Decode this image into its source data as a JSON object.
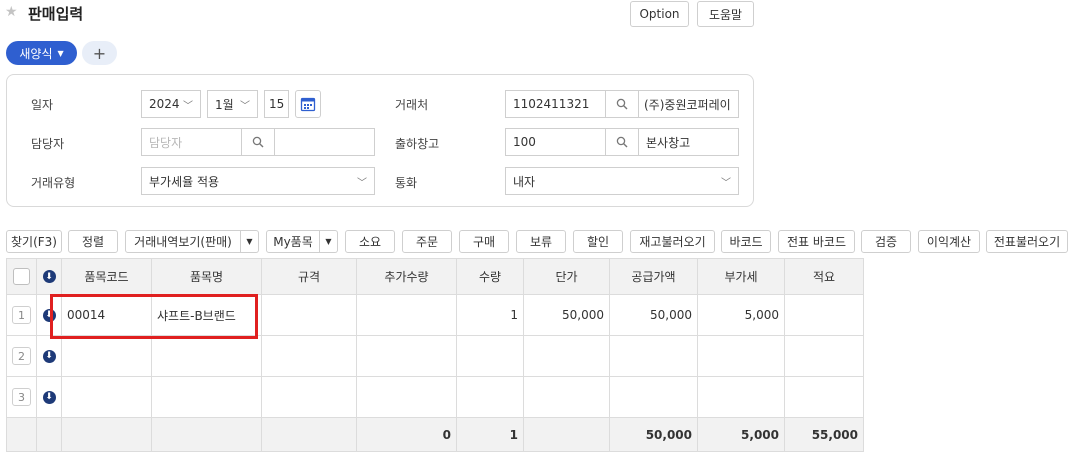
{
  "header": {
    "title": "판매입력",
    "option_label": "Option",
    "help_label": "도움말",
    "new_form_label": "새양식",
    "add_label": "+"
  },
  "form": {
    "date_label": "일자",
    "year": "2024",
    "month": "1월",
    "day": "15",
    "manager_label": "담당자",
    "manager_placeholder": "담당자",
    "trade_type_label": "거래유형",
    "trade_type_value": "부가세율 적용",
    "customer_label": "거래처",
    "customer_code": "1102411321",
    "customer_name": "(주)중원코퍼레이",
    "warehouse_label": "출하창고",
    "warehouse_code": "100",
    "warehouse_name": "본사창고",
    "currency_label": "통화",
    "currency_value": "내자"
  },
  "toolbar": {
    "find": "찾기(F3)",
    "sort": "정렬",
    "history": "거래내역보기(판매)",
    "my_items": "My품목",
    "consume": "소요",
    "order": "주문",
    "purchase": "구매",
    "hold": "보류",
    "discount": "할인",
    "stock_load": "재고불러오기",
    "barcode": "바코드",
    "slip_barcode": "전표 바코드",
    "verify": "검증",
    "profit": "이익계산",
    "slip_load": "전표불러오기"
  },
  "grid": {
    "headers": {
      "code": "품목코드",
      "name": "품목명",
      "spec": "규격",
      "extra_qty": "추가수량",
      "qty": "수량",
      "price": "단가",
      "supply": "공급가액",
      "vat": "부가세",
      "memo": "적요"
    },
    "rows": [
      {
        "num": "1",
        "code": "00014",
        "name": "샤프트-B브랜드",
        "spec": "",
        "extra_qty": "",
        "qty": "1",
        "price": "50,000",
        "supply": "50,000",
        "vat": "5,000",
        "memo": ""
      },
      {
        "num": "2",
        "code": "",
        "name": "",
        "spec": "",
        "extra_qty": "",
        "qty": "",
        "price": "",
        "supply": "",
        "vat": "",
        "memo": ""
      },
      {
        "num": "3",
        "code": "",
        "name": "",
        "spec": "",
        "extra_qty": "",
        "qty": "",
        "price": "",
        "supply": "",
        "vat": "",
        "memo": ""
      }
    ],
    "totals": {
      "extra_qty": "0",
      "qty": "1",
      "supply": "50,000",
      "vat": "5,000",
      "memo": "55,000"
    }
  },
  "colors": {
    "accent": "#2f5fd0",
    "highlight": "#e02020",
    "download_icon": "#1e3a78"
  }
}
